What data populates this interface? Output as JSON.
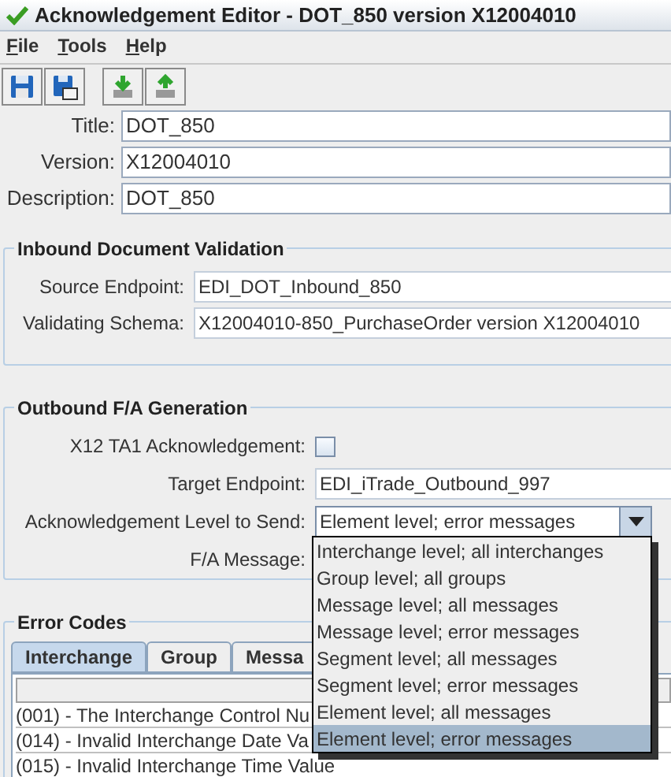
{
  "window": {
    "title": "Acknowledgement Editor - DOT_850 version X12004010"
  },
  "menu": [
    "File",
    "Tools",
    "Help"
  ],
  "toolbar": [
    {
      "kind": "save"
    },
    {
      "kind": "save-as"
    },
    {
      "kind": "import"
    },
    {
      "kind": "export"
    }
  ],
  "header_fields": [
    {
      "label": "Title:",
      "value": "DOT_850"
    },
    {
      "label": "Version:",
      "value": "X12004010"
    },
    {
      "label": "Description:",
      "value": "DOT_850"
    }
  ],
  "inbound": {
    "title": "Inbound Document Validation",
    "fields": [
      {
        "label": "Source Endpoint:",
        "value": "EDI_DOT_Inbound_850"
      },
      {
        "label": "Validating Schema:",
        "value": "X12004010-850_PurchaseOrder version X12004010"
      }
    ]
  },
  "outbound": {
    "title": "Outbound F/A Generation",
    "ta1": {
      "label": "X12 TA1 Acknowledgement:",
      "checked": false
    },
    "target": {
      "label": "Target Endpoint:",
      "value": "EDI_iTrade_Outbound_997"
    },
    "level": {
      "label": "Acknowledgement Level to Send:",
      "value": "Element level; error messages",
      "expanded": true,
      "options": [
        {
          "label": "Interchange level; all interchanges",
          "selected": false
        },
        {
          "label": "Group level; all groups",
          "selected": false
        },
        {
          "label": "Message level; all messages",
          "selected": false
        },
        {
          "label": "Message level; error messages",
          "selected": false
        },
        {
          "label": "Segment level; all messages",
          "selected": false
        },
        {
          "label": "Segment level; error messages",
          "selected": false
        },
        {
          "label": "Element level; all messages",
          "selected": false
        },
        {
          "label": "Element level; error messages",
          "selected": true
        }
      ]
    },
    "fa_message": {
      "label": "F/A Message:"
    }
  },
  "error_codes": {
    "title": "Error Codes",
    "tabs": [
      {
        "label": "Interchange",
        "selected": true
      },
      {
        "label": "Group",
        "selected": false
      },
      {
        "label": "Messa",
        "selected": false
      }
    ],
    "rows": [
      "(001) - The Interchange Control Nu",
      "(014) - Invalid Interchange Date Va",
      "(015) - Invalid Interchange Time Value"
    ]
  }
}
